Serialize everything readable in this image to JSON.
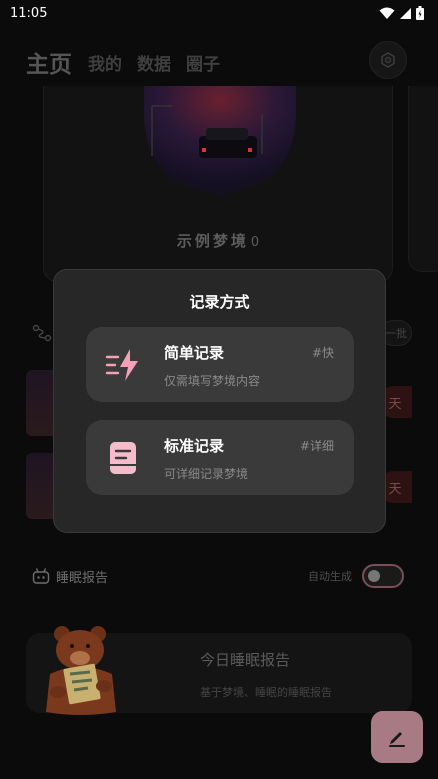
{
  "status_bar": {
    "time": "11:05"
  },
  "header": {
    "tabs": [
      {
        "label": "主页"
      },
      {
        "label": "我的"
      },
      {
        "label": "数据"
      },
      {
        "label": "圈子"
      }
    ]
  },
  "dream_card": {
    "title": "示例梦境",
    "count": "0"
  },
  "background": {
    "pill_text": "一批",
    "tag_text": "天"
  },
  "sleep_report": {
    "section_label": "睡眠报告",
    "auto_generate_label": "自动生成",
    "card_title": "今日睡眠报告",
    "card_subtitle": "基于梦境、睡眠的睡眠报告"
  },
  "modal": {
    "title": "记录方式",
    "options": [
      {
        "title": "简单记录",
        "description": "仅需填写梦境内容",
        "tag": "#快",
        "icon": "lightning-icon"
      },
      {
        "title": "标准记录",
        "description": "可详细记录梦境",
        "tag": "#详细",
        "icon": "document-icon"
      }
    ]
  },
  "colors": {
    "accent": "#f5a0b4",
    "fab": "#a87a84",
    "modal_bg": "#272727"
  }
}
